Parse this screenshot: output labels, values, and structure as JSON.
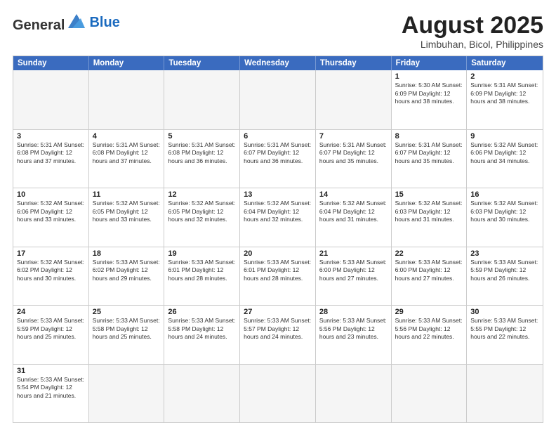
{
  "header": {
    "logo_text_general": "General",
    "logo_text_blue": "Blue",
    "month_year": "August 2025",
    "location": "Limbuhan, Bicol, Philippines"
  },
  "calendar": {
    "days_of_week": [
      "Sunday",
      "Monday",
      "Tuesday",
      "Wednesday",
      "Thursday",
      "Friday",
      "Saturday"
    ],
    "weeks": [
      [
        {
          "day": "",
          "info": ""
        },
        {
          "day": "",
          "info": ""
        },
        {
          "day": "",
          "info": ""
        },
        {
          "day": "",
          "info": ""
        },
        {
          "day": "",
          "info": ""
        },
        {
          "day": "1",
          "info": "Sunrise: 5:30 AM\nSunset: 6:09 PM\nDaylight: 12 hours and 38 minutes."
        },
        {
          "day": "2",
          "info": "Sunrise: 5:31 AM\nSunset: 6:09 PM\nDaylight: 12 hours and 38 minutes."
        }
      ],
      [
        {
          "day": "3",
          "info": "Sunrise: 5:31 AM\nSunset: 6:08 PM\nDaylight: 12 hours and 37 minutes."
        },
        {
          "day": "4",
          "info": "Sunrise: 5:31 AM\nSunset: 6:08 PM\nDaylight: 12 hours and 37 minutes."
        },
        {
          "day": "5",
          "info": "Sunrise: 5:31 AM\nSunset: 6:08 PM\nDaylight: 12 hours and 36 minutes."
        },
        {
          "day": "6",
          "info": "Sunrise: 5:31 AM\nSunset: 6:07 PM\nDaylight: 12 hours and 36 minutes."
        },
        {
          "day": "7",
          "info": "Sunrise: 5:31 AM\nSunset: 6:07 PM\nDaylight: 12 hours and 35 minutes."
        },
        {
          "day": "8",
          "info": "Sunrise: 5:31 AM\nSunset: 6:07 PM\nDaylight: 12 hours and 35 minutes."
        },
        {
          "day": "9",
          "info": "Sunrise: 5:32 AM\nSunset: 6:06 PM\nDaylight: 12 hours and 34 minutes."
        }
      ],
      [
        {
          "day": "10",
          "info": "Sunrise: 5:32 AM\nSunset: 6:06 PM\nDaylight: 12 hours and 33 minutes."
        },
        {
          "day": "11",
          "info": "Sunrise: 5:32 AM\nSunset: 6:05 PM\nDaylight: 12 hours and 33 minutes."
        },
        {
          "day": "12",
          "info": "Sunrise: 5:32 AM\nSunset: 6:05 PM\nDaylight: 12 hours and 32 minutes."
        },
        {
          "day": "13",
          "info": "Sunrise: 5:32 AM\nSunset: 6:04 PM\nDaylight: 12 hours and 32 minutes."
        },
        {
          "day": "14",
          "info": "Sunrise: 5:32 AM\nSunset: 6:04 PM\nDaylight: 12 hours and 31 minutes."
        },
        {
          "day": "15",
          "info": "Sunrise: 5:32 AM\nSunset: 6:03 PM\nDaylight: 12 hours and 31 minutes."
        },
        {
          "day": "16",
          "info": "Sunrise: 5:32 AM\nSunset: 6:03 PM\nDaylight: 12 hours and 30 minutes."
        }
      ],
      [
        {
          "day": "17",
          "info": "Sunrise: 5:32 AM\nSunset: 6:02 PM\nDaylight: 12 hours and 30 minutes."
        },
        {
          "day": "18",
          "info": "Sunrise: 5:33 AM\nSunset: 6:02 PM\nDaylight: 12 hours and 29 minutes."
        },
        {
          "day": "19",
          "info": "Sunrise: 5:33 AM\nSunset: 6:01 PM\nDaylight: 12 hours and 28 minutes."
        },
        {
          "day": "20",
          "info": "Sunrise: 5:33 AM\nSunset: 6:01 PM\nDaylight: 12 hours and 28 minutes."
        },
        {
          "day": "21",
          "info": "Sunrise: 5:33 AM\nSunset: 6:00 PM\nDaylight: 12 hours and 27 minutes."
        },
        {
          "day": "22",
          "info": "Sunrise: 5:33 AM\nSunset: 6:00 PM\nDaylight: 12 hours and 27 minutes."
        },
        {
          "day": "23",
          "info": "Sunrise: 5:33 AM\nSunset: 5:59 PM\nDaylight: 12 hours and 26 minutes."
        }
      ],
      [
        {
          "day": "24",
          "info": "Sunrise: 5:33 AM\nSunset: 5:59 PM\nDaylight: 12 hours and 25 minutes."
        },
        {
          "day": "25",
          "info": "Sunrise: 5:33 AM\nSunset: 5:58 PM\nDaylight: 12 hours and 25 minutes."
        },
        {
          "day": "26",
          "info": "Sunrise: 5:33 AM\nSunset: 5:58 PM\nDaylight: 12 hours and 24 minutes."
        },
        {
          "day": "27",
          "info": "Sunrise: 5:33 AM\nSunset: 5:57 PM\nDaylight: 12 hours and 24 minutes."
        },
        {
          "day": "28",
          "info": "Sunrise: 5:33 AM\nSunset: 5:56 PM\nDaylight: 12 hours and 23 minutes."
        },
        {
          "day": "29",
          "info": "Sunrise: 5:33 AM\nSunset: 5:56 PM\nDaylight: 12 hours and 22 minutes."
        },
        {
          "day": "30",
          "info": "Sunrise: 5:33 AM\nSunset: 5:55 PM\nDaylight: 12 hours and 22 minutes."
        }
      ],
      [
        {
          "day": "31",
          "info": "Sunrise: 5:33 AM\nSunset: 5:54 PM\nDaylight: 12 hours and 21 minutes."
        },
        {
          "day": "",
          "info": ""
        },
        {
          "day": "",
          "info": ""
        },
        {
          "day": "",
          "info": ""
        },
        {
          "day": "",
          "info": ""
        },
        {
          "day": "",
          "info": ""
        },
        {
          "day": "",
          "info": ""
        }
      ]
    ]
  }
}
